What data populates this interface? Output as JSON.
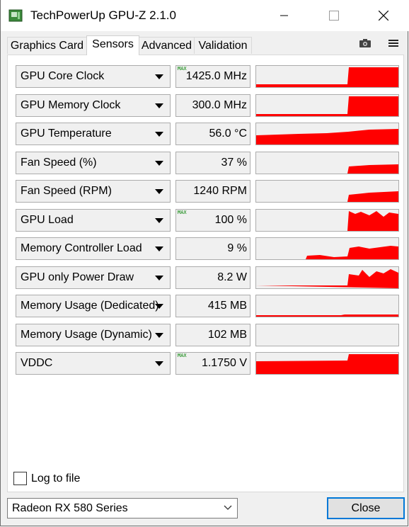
{
  "window": {
    "title": "TechPowerUp GPU-Z 2.1.0",
    "accent": "#0078d7",
    "graph_color": "#ff0000"
  },
  "tabs": [
    {
      "label": "Graphics Card",
      "active": false
    },
    {
      "label": "Sensors",
      "active": true
    },
    {
      "label": "Advanced",
      "active": false
    },
    {
      "label": "Validation",
      "active": false
    }
  ],
  "toolbar": {
    "camera_icon": "camera-icon",
    "menu_icon": "hamburger-menu-icon"
  },
  "sensors": [
    {
      "name": "GPU Core Clock",
      "value": "1425.0 MHz",
      "max_tag": "MAX"
    },
    {
      "name": "GPU Memory Clock",
      "value": "300.0 MHz",
      "max_tag": ""
    },
    {
      "name": "GPU Temperature",
      "value": "56.0 °C",
      "max_tag": ""
    },
    {
      "name": "Fan Speed (%)",
      "value": "37 %",
      "max_tag": ""
    },
    {
      "name": "Fan Speed (RPM)",
      "value": "1240 RPM",
      "max_tag": ""
    },
    {
      "name": "GPU Load",
      "value": "100 %",
      "max_tag": "MAX"
    },
    {
      "name": "Memory Controller Load",
      "value": "9 %",
      "max_tag": ""
    },
    {
      "name": "GPU only Power Draw",
      "value": "8.2 W",
      "max_tag": ""
    },
    {
      "name": "Memory Usage (Dedicated)",
      "value": "415 MB",
      "max_tag": ""
    },
    {
      "name": "Memory Usage (Dynamic)",
      "value": "102 MB",
      "max_tag": ""
    },
    {
      "name": "VDDC",
      "value": "1.1750 V",
      "max_tag": "MAX"
    }
  ],
  "log_to_file": {
    "label": "Log to file",
    "checked": false
  },
  "gpu_selector": {
    "value": "Radeon RX 580 Series"
  },
  "close_button": {
    "label": "Close"
  }
}
